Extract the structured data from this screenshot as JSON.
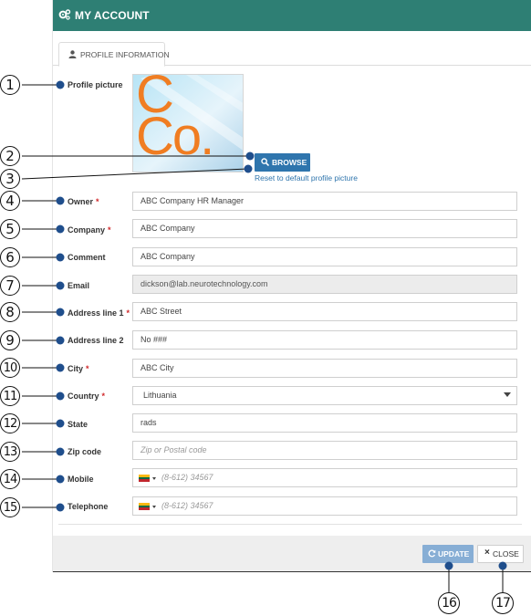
{
  "header": {
    "title": "MY ACCOUNT",
    "icon": "gears-icon"
  },
  "tab": {
    "label": "PROFILE INFORMATION",
    "icon": "user-icon"
  },
  "profile": {
    "label": "Profile picture",
    "picture_text": "Co.",
    "browse_label": "BROWSE",
    "reset_label": "Reset to default profile picture"
  },
  "fields": {
    "owner": {
      "label": "Owner",
      "value": "ABC Company HR Manager",
      "required": "*"
    },
    "company": {
      "label": "Company",
      "value": "ABC Company",
      "required": "*"
    },
    "comment": {
      "label": "Comment",
      "value": "ABC Company"
    },
    "email": {
      "label": "Email",
      "value": "dickson@lab.neurotechnology.com"
    },
    "address1": {
      "label": "Address line 1",
      "value": "ABC Street",
      "required": "*"
    },
    "address2": {
      "label": "Address line 2",
      "value": "No ###"
    },
    "city": {
      "label": "City",
      "value": "ABC City",
      "required": "*"
    },
    "country": {
      "label": "Country",
      "value": "Lithuania",
      "required": "*"
    },
    "state": {
      "label": "State",
      "value": "rads"
    },
    "zip": {
      "label": "Zip code",
      "placeholder": "Zip or Postal code"
    },
    "mobile": {
      "label": "Mobile",
      "placeholder": "(8-612) 34567"
    },
    "telephone": {
      "label": "Telephone",
      "placeholder": "(8-612) 34567"
    }
  },
  "footer": {
    "update_label": "UPDATE",
    "close_label": "CLOSE"
  },
  "annotations": [
    "1",
    "2",
    "3",
    "4",
    "5",
    "6",
    "7",
    "8",
    "9",
    "10",
    "11",
    "12",
    "13",
    "14",
    "15",
    "16",
    "17"
  ],
  "colors": {
    "header": "#2e7f74",
    "primary": "#2f75ad",
    "required": "#d0282b",
    "annotation": "#1f4e8c"
  }
}
